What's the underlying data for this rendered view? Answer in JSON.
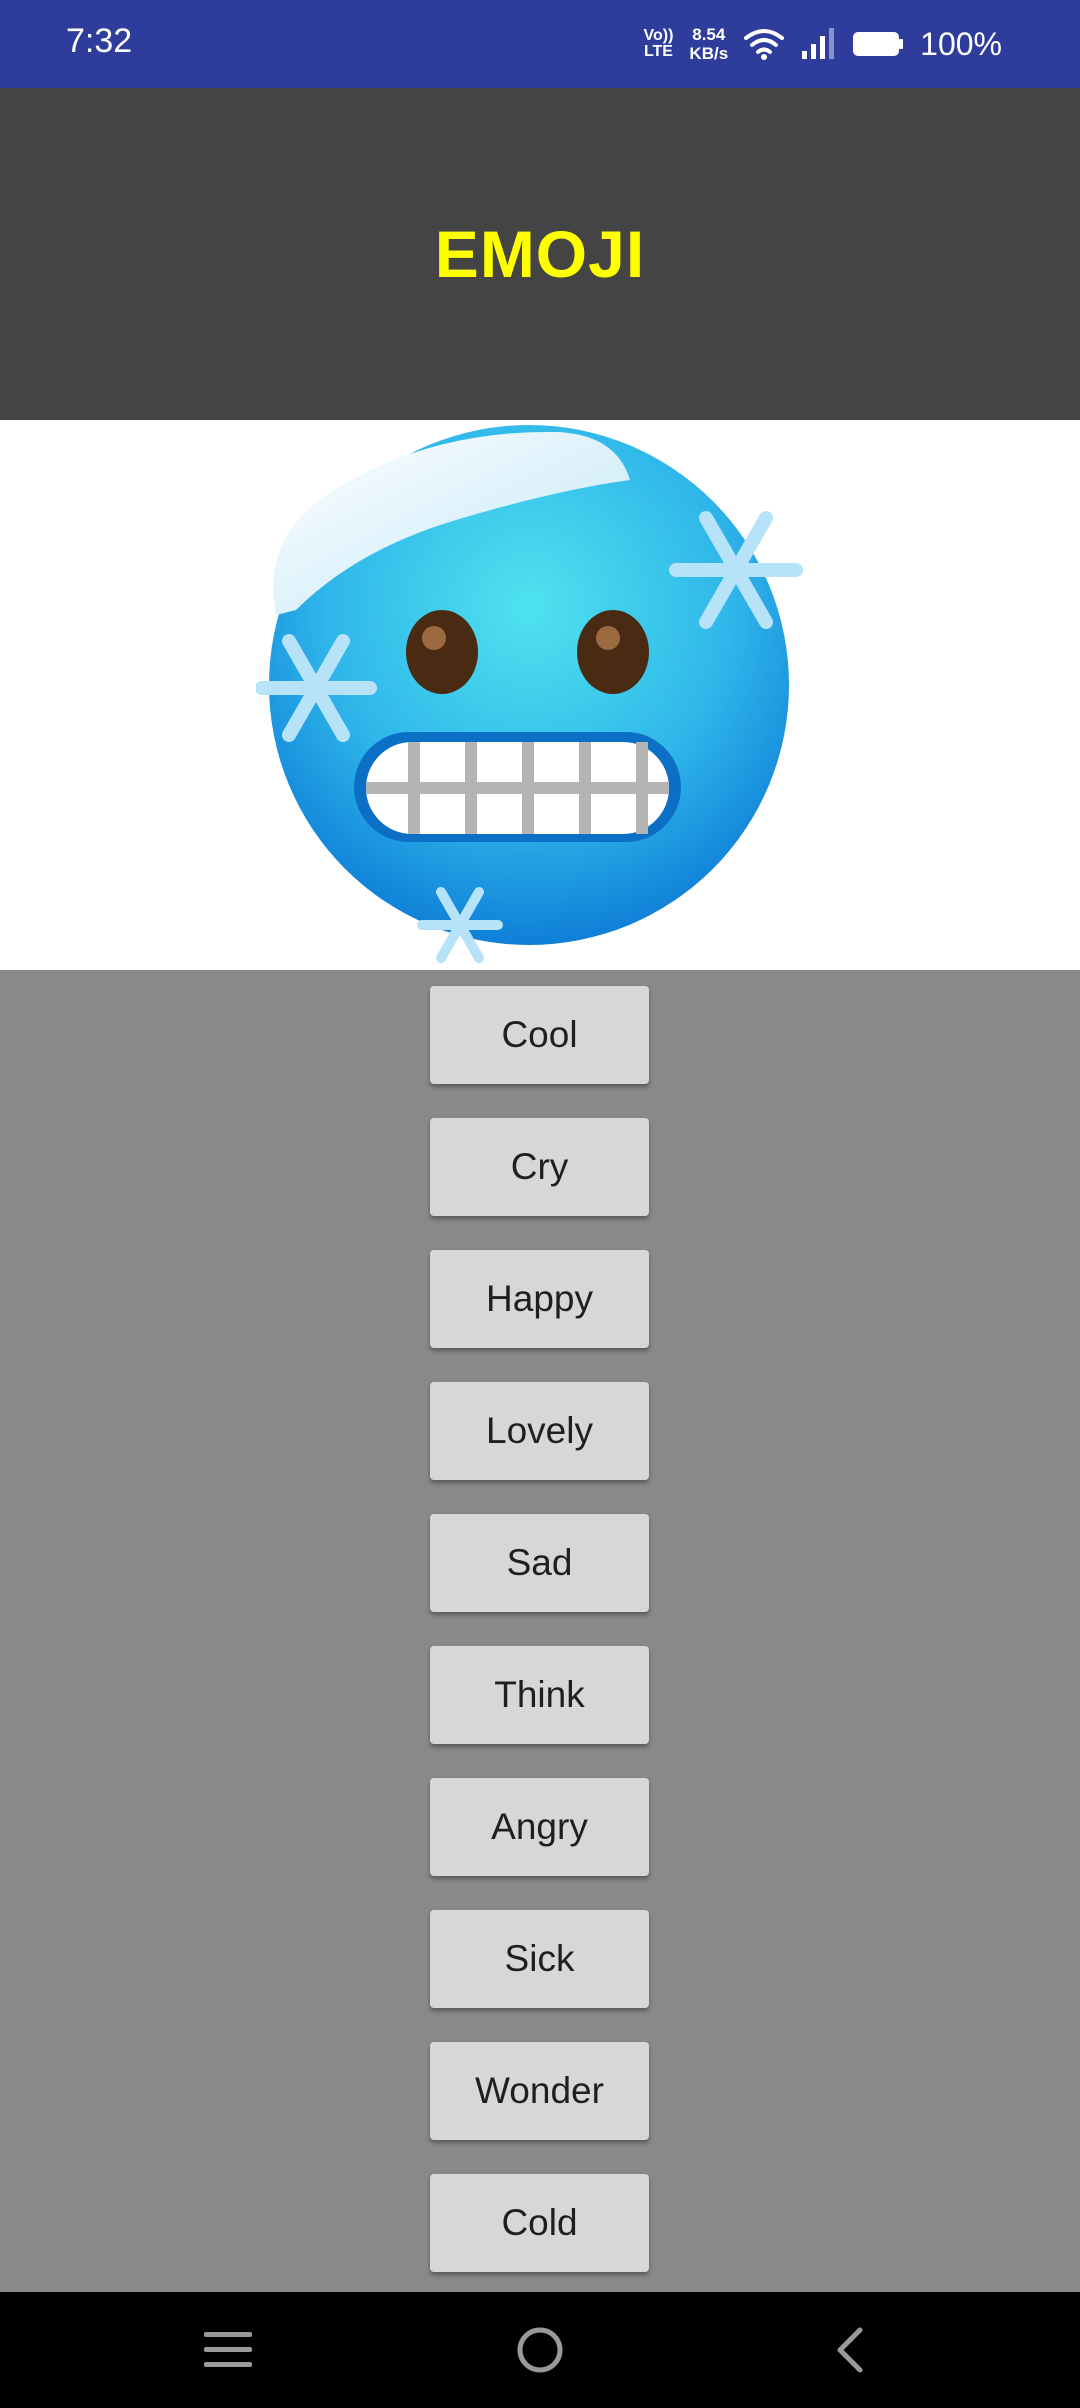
{
  "status_bar": {
    "time": "7:32",
    "volte_top": "Vo))",
    "volte_bottom": "LTE",
    "speed_value": "8.54",
    "speed_unit": "KB/s",
    "battery_percent": "100%"
  },
  "header": {
    "title": "EMOJI",
    "title_color": "#ffff00",
    "background": "#444444"
  },
  "emoji_image": {
    "icon": "cold-face-emoji"
  },
  "buttons": [
    {
      "label": "Cool"
    },
    {
      "label": "Cry"
    },
    {
      "label": "Happy"
    },
    {
      "label": "Lovely"
    },
    {
      "label": "Sad"
    },
    {
      "label": "Think"
    },
    {
      "label": "Angry"
    },
    {
      "label": "Sick"
    },
    {
      "label": "Wonder"
    },
    {
      "label": "Cold"
    }
  ],
  "nav_bar": {
    "icons": [
      "menu-icon",
      "home-icon",
      "back-icon"
    ]
  }
}
